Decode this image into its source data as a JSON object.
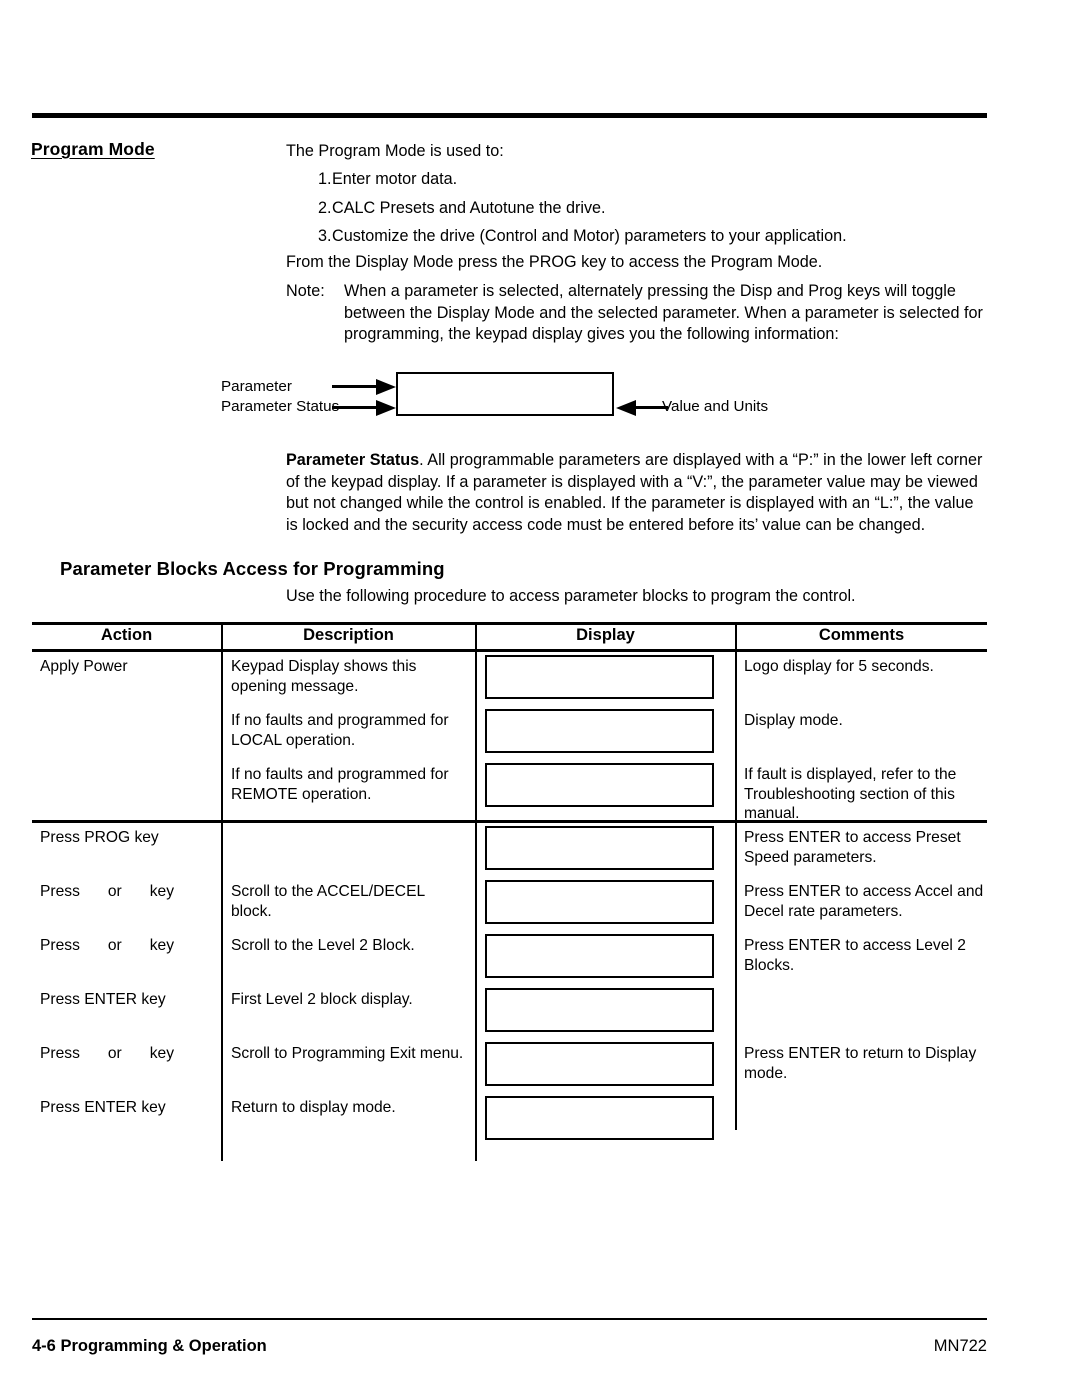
{
  "page": {
    "section_title": "Program Mode",
    "sub_title": "Parameter Blocks Access for Programming"
  },
  "intro": {
    "lead": "The Program Mode is used to:",
    "items": [
      {
        "num": "1.",
        "text": "Enter motor data."
      },
      {
        "num": "2.",
        "text": "CALC Presets and Autotune the drive."
      },
      {
        "num": "3.",
        "text": "Customize the drive (Control and Motor) parameters to your application."
      }
    ],
    "from_line": "From the Display Mode press the PROG key to access the Program Mode.",
    "note_label": "Note:",
    "note_body": "When a parameter is selected, alternately pressing the Disp and Prog keys will toggle between the Display Mode and the selected parameter.  When a parameter is selected for programming, the keypad display gives you the following information:"
  },
  "diagram": {
    "label_parameter": "Parameter",
    "label_parameter_status": "Parameter Status",
    "label_value_units": "Value and Units"
  },
  "status_paragraph": {
    "bold_lead": "Parameter Status",
    "rest": ".  All programmable parameters are displayed with a “P:” in the lower left corner of the keypad display.  If a parameter is displayed with a “V:”, the parameter value may be viewed but not changed while the control is enabled.  If the parameter is displayed with an “L:”, the value is locked and the security access code must be entered before its’ value can be changed."
  },
  "procedure_intro": "Use the following procedure to access parameter blocks to program the control.",
  "table": {
    "headers": {
      "action": "Action",
      "description": "Description",
      "display": "Display",
      "comments": "Comments"
    },
    "rows": [
      {
        "action": "Apply Power",
        "description": "Keypad Display shows this opening message.",
        "display": "",
        "comments": "Logo display for 5 seconds."
      },
      {
        "action": "",
        "description": "If no faults and programmed for LOCAL operation.",
        "display": "",
        "comments": "Display mode."
      },
      {
        "action": "",
        "description": "If no faults and programmed for REMOTE operation.",
        "display": "",
        "comments": "If fault is displayed, refer to the Troubleshooting section of this manual."
      },
      {
        "action": "Press PROG key",
        "description": "",
        "display": "",
        "comments": "Press ENTER to access Preset Speed parameters."
      },
      {
        "action_prefix": "Press",
        "action_middle": "or",
        "action_suffix": "key",
        "action": "",
        "description": "Scroll to the ACCEL/DECEL block.",
        "display": "",
        "comments": "Press ENTER to access Accel and Decel rate parameters."
      },
      {
        "action_prefix": "Press",
        "action_middle": "or",
        "action_suffix": "key",
        "action": "",
        "description": "Scroll to the Level 2 Block.",
        "display": "",
        "comments": "Press ENTER to access Level 2 Blocks."
      },
      {
        "action": "Press ENTER key",
        "description": "First Level 2 block display.",
        "display": "",
        "comments": ""
      },
      {
        "action_prefix": "Press",
        "action_middle": "or",
        "action_suffix": "key",
        "action": "",
        "description": "Scroll to Programming Exit menu.",
        "display": "",
        "comments": "Press ENTER to return to Display mode."
      },
      {
        "action": "Press ENTER key",
        "description": "Return to display mode.",
        "display": "",
        "comments": ""
      }
    ]
  },
  "footer": {
    "page_number": "4-6",
    "chapter": "Programming & Operation",
    "doc_code": "MN722"
  }
}
